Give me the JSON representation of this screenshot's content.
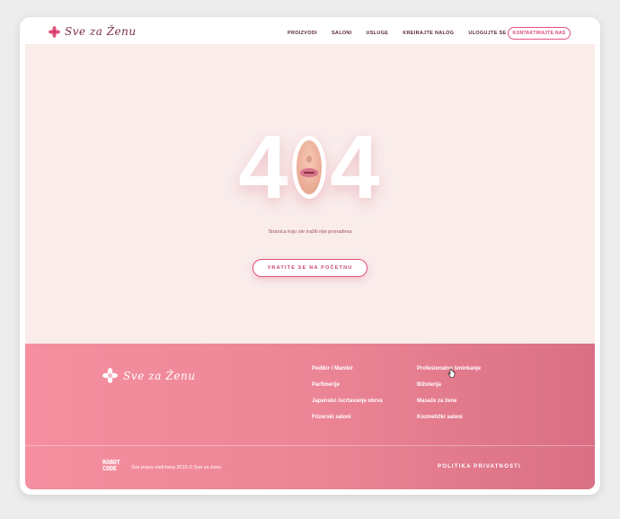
{
  "header": {
    "logo_text": "Sve za Ženu",
    "logo_icon": "flower-icon",
    "menu": [
      "PROIZVODI",
      "SALONI",
      "USLUGE",
      "KREIRAJTE NALOG",
      "ULOGUJTE SE"
    ],
    "contact_label": "KONTAKTIRAJTE NAS"
  },
  "error": {
    "code_left": "4",
    "code_right": "4",
    "message": "Stranica koju ste tražili nije pronađena",
    "home_button": "VRATITE SE NA POČETNU"
  },
  "footer": {
    "logo_text": "Sve za Ženu",
    "links_col1": [
      "Pedikir i Manikir",
      "Parfimerije",
      "Japansko iscrtavanje obrva",
      "Frizerski saloni"
    ],
    "links_col2": [
      "Profesionalno šminkanje",
      "Bižuterija",
      "Masaže za žene",
      "Kozmetički saloni"
    ],
    "robot_logo": "RöBOT CODE",
    "copyright": "Sve prava zadržana 2019 © Sve za ženu",
    "privacy": "POLITIKA PRIVATNOSTI"
  },
  "colors": {
    "accent": "#e2517c",
    "page_bg": "#f9eceb",
    "footer_start": "#f58fa0",
    "footer_end": "#d96f84"
  }
}
